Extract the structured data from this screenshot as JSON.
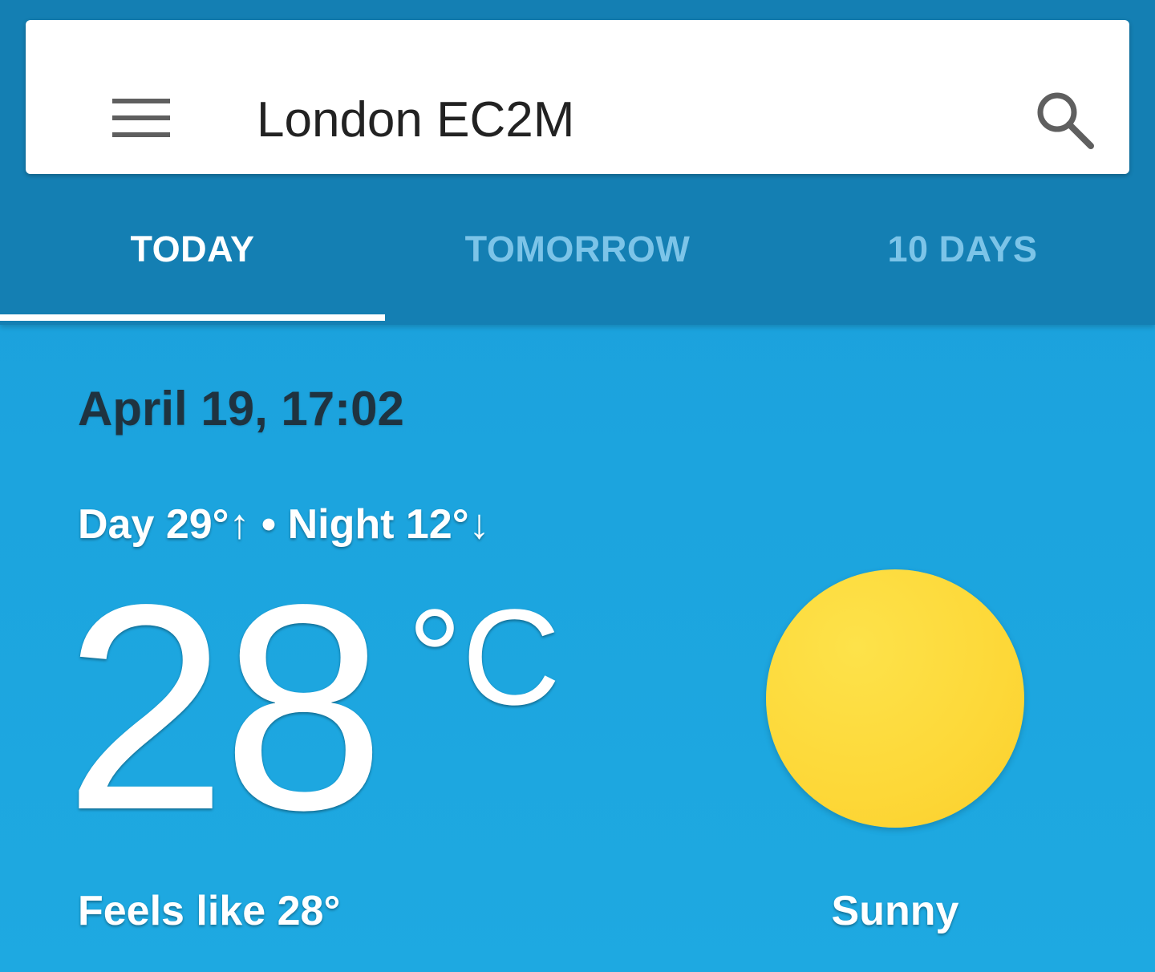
{
  "search": {
    "location": "London EC2M"
  },
  "tabs": [
    {
      "label": "TODAY",
      "active": true
    },
    {
      "label": "TOMORROW",
      "active": false
    },
    {
      "label": "10 DAYS",
      "active": false
    }
  ],
  "weather": {
    "datetime": "April 19, 17:02",
    "day_night": "Day 29°↑ • Night 12°↓",
    "temperature": "28",
    "unit": "°C",
    "feels_like": "Feels like 28°",
    "condition": "Sunny",
    "condition_icon": "sun-icon"
  },
  "colors": {
    "header_bg": "#147fb3",
    "content_bg": "#1ea9e1",
    "sun": "#fdd838",
    "inactive_tab": "#7cc4e8"
  }
}
